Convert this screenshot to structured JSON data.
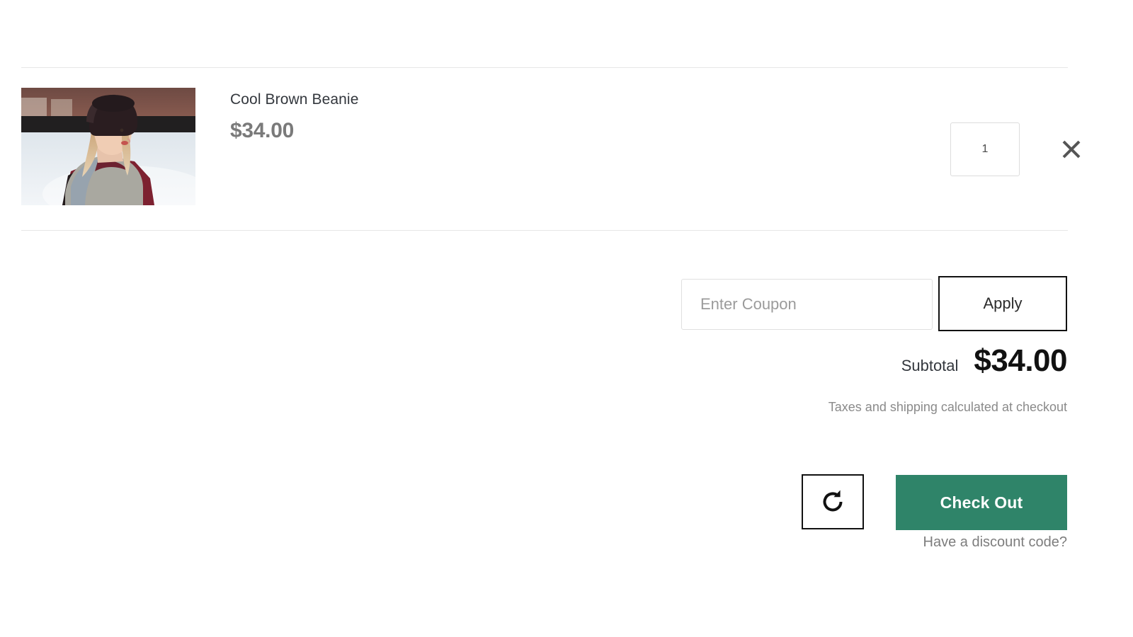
{
  "cart": {
    "items": [
      {
        "title": "Cool Brown Beanie",
        "price": "$34.00",
        "quantity": "1",
        "thumbnail_alt": "Woman wearing dark brown beanie and gray scarf in snow",
        "remove_icon": "close-x-icon"
      }
    ]
  },
  "coupon": {
    "placeholder": "Enter Coupon",
    "value": "",
    "apply_label": "Apply"
  },
  "totals": {
    "subtotal_label": "Subtotal",
    "subtotal_value": "$34.00",
    "tax_note": "Taxes and shipping calculated at checkout"
  },
  "actions": {
    "update_cart_icon": "refresh-icon",
    "checkout_label": "Check Out",
    "discount_link_label": "Have a discount code?"
  },
  "colors": {
    "checkout_green": "#2f8469",
    "border_black": "#111111",
    "divider_gray": "#e6e6e6",
    "price_gray": "#7a7a7a",
    "muted_text": "#8a8a8a"
  }
}
